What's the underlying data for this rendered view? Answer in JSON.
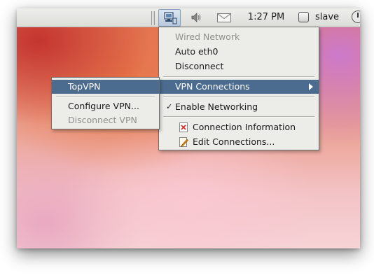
{
  "panel": {
    "clock": "1:27 PM",
    "user": "slave",
    "icons": [
      "network-manager-icon",
      "volume-icon",
      "mail-icon",
      "user-checkbox-icon",
      "power-icon"
    ]
  },
  "network_menu": {
    "section_header": "Wired Network",
    "items": {
      "auto_eth0": "Auto eth0",
      "disconnect": "Disconnect",
      "vpn_connections": "VPN Connections",
      "enable_networking": "Enable Networking",
      "enable_networking_checked": true,
      "connection_information": "Connection Information",
      "edit_connections": "Edit Connections..."
    },
    "highlight_color": "#4b6c8f"
  },
  "vpn_submenu": {
    "items": {
      "topvpn": "TopVPN",
      "configure_vpn": "Configure VPN...",
      "disconnect_vpn": "Disconnect VPN"
    }
  }
}
